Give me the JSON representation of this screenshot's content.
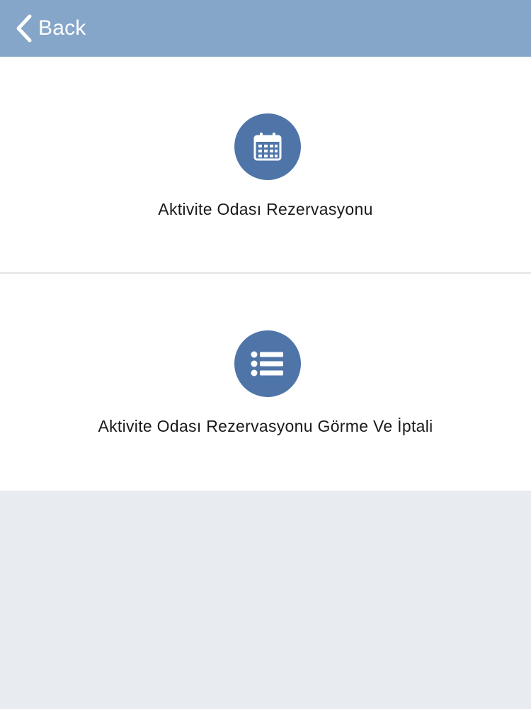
{
  "navbar": {
    "back_label": "Back",
    "back_icon": "chevron-left-icon"
  },
  "menu": {
    "items": [
      {
        "label": "Aktivite Odası Rezervasyonu",
        "icon": "calendar-icon"
      },
      {
        "label": "Aktivite Odası Rezervasyonu Görme Ve İptali",
        "icon": "list-icon"
      }
    ]
  },
  "colors": {
    "navbar": "#85a5c9",
    "icon_circle": "#4f75a8",
    "background": "#e8ecf1",
    "separator": "#e3e3e3"
  }
}
